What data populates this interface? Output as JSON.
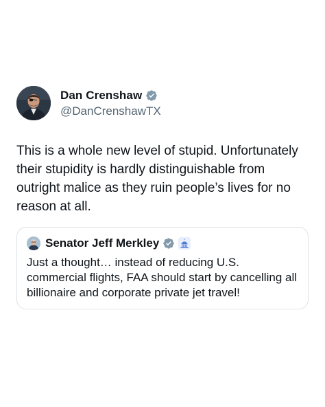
{
  "tweet": {
    "author": {
      "display_name": "Dan Crenshaw",
      "handle": "@DanCrenshawTX",
      "avatar_icon": "profile-photo",
      "verified_icon": "verified-badge-icon"
    },
    "text": "This is a whole new level of stupid. Unfortunately their stupidity is hardly distinguishable from outright malice as they ruin people’s lives for no reason at all."
  },
  "quoted_tweet": {
    "author": {
      "display_name": "Senator Jeff Merkley",
      "avatar_icon": "profile-photo",
      "verified_icon": "verified-badge-icon",
      "affiliation_icon": "government-capitol-badge-icon"
    },
    "text": "Just a thought… instead of reducing U.S. commercial flights, FAA should start by cancelling all billionaire and corporate private jet travel!"
  },
  "colors": {
    "text_primary": "#0f1419",
    "text_secondary": "#536471",
    "verified_gray": "#829aab",
    "card_border": "#dde3e8",
    "gov_badge_blue": "#4f7bd8"
  }
}
